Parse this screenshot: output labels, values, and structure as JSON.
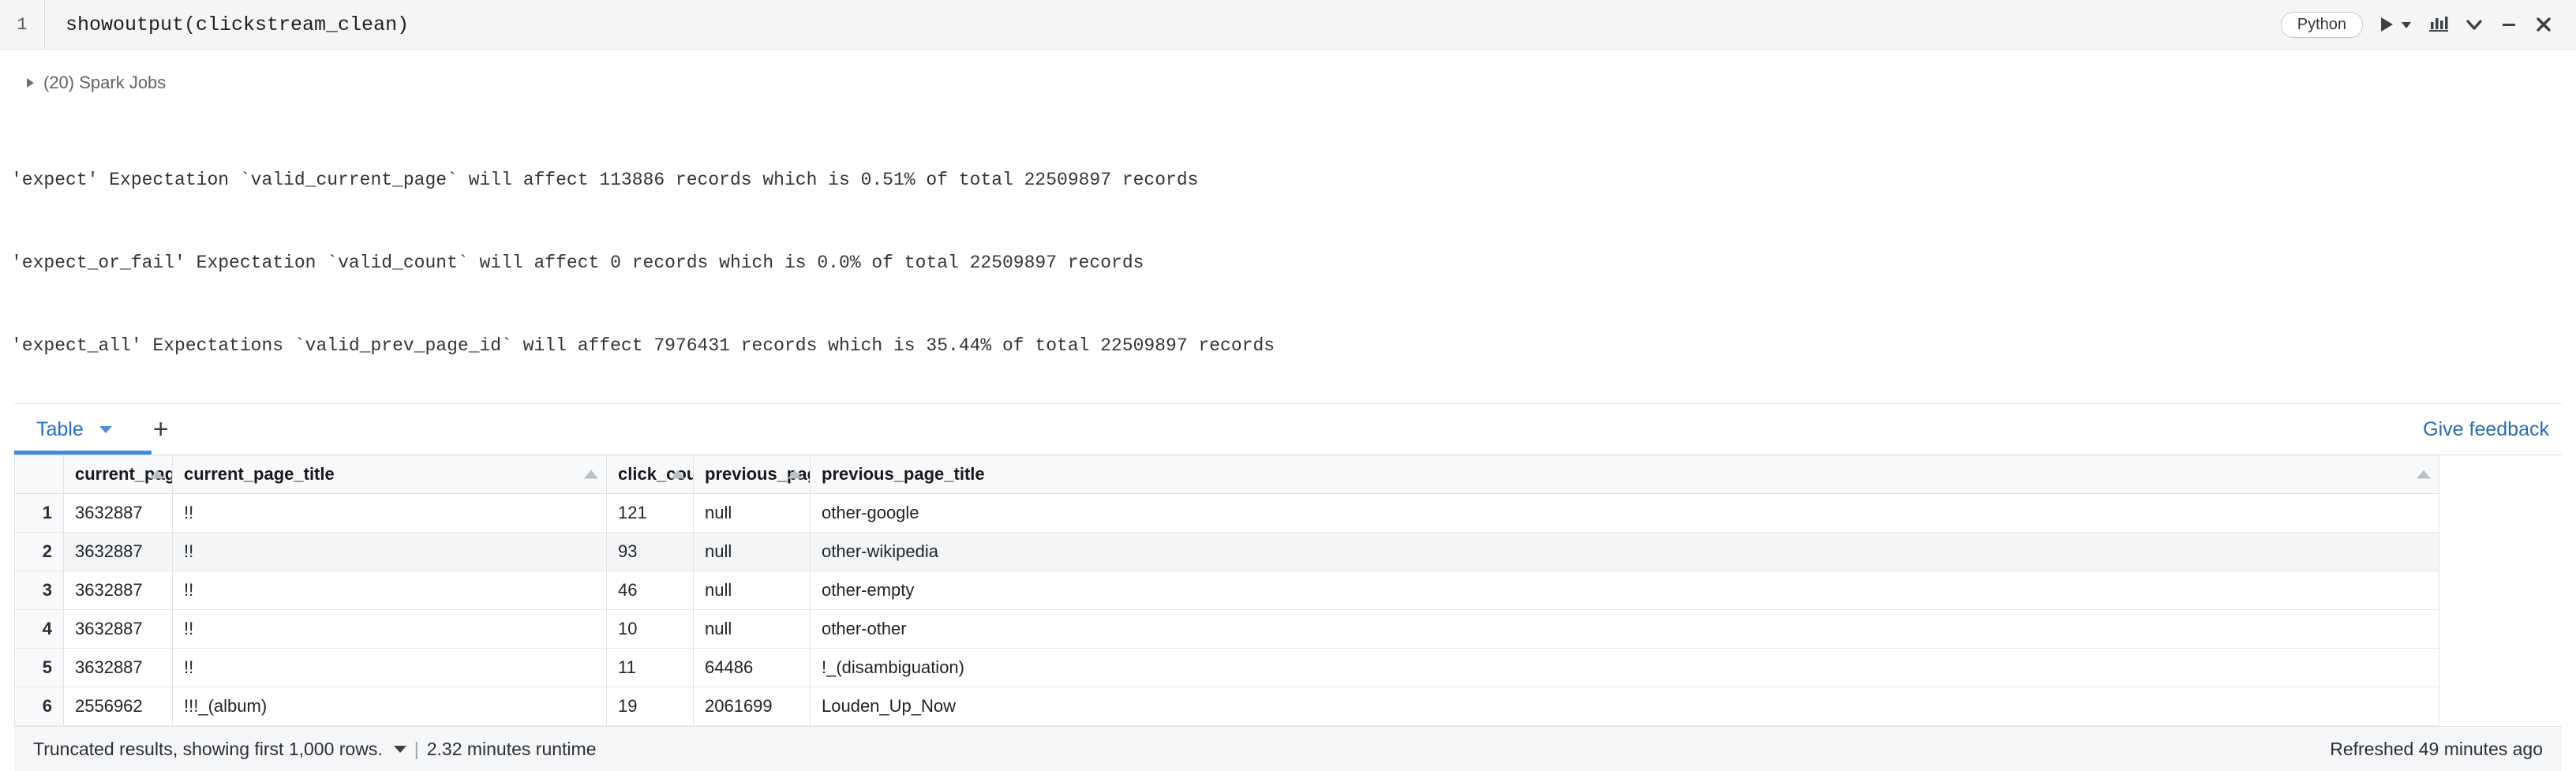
{
  "code_cell": {
    "line_number": "1",
    "code": "showoutput(clickstream_clean)",
    "language_badge": "Python",
    "icons": {
      "run": "run-icon",
      "run_dropdown": "run-dropdown-caret-icon",
      "chart": "chart-icon",
      "collapse": "chevron-down-icon",
      "minimize": "minimize-icon",
      "close": "close-icon"
    }
  },
  "spark_jobs": {
    "caret": "expand-caret-icon",
    "label": "(20) Spark Jobs"
  },
  "expectations": [
    "'expect' Expectation `valid_current_page` will affect 113886 records which is 0.51% of total 22509897 records",
    "'expect_or_fail' Expectation `valid_count` will affect 0 records which is 0.0% of total 22509897 records",
    "'expect_all' Expectations `valid_prev_page_id` will affect 7976431 records which is 35.44% of total 22509897 records"
  ],
  "result_panel": {
    "tabs": [
      {
        "label": "Table",
        "active": true
      }
    ],
    "add_tab_label": "+",
    "feedback_label": "Give feedback",
    "table": {
      "index_header": "",
      "columns": [
        {
          "name": "current_page_id",
          "sortable": true
        },
        {
          "name": "current_page_title",
          "sortable": true
        },
        {
          "name": "click_count",
          "sortable": true
        },
        {
          "name": "previous_page_id",
          "sortable": true
        },
        {
          "name": "previous_page_title",
          "sortable": true
        }
      ],
      "rows": [
        {
          "index": "1",
          "current_page_id": "3632887",
          "current_page_title": "!!",
          "click_count": "121",
          "previous_page_id": "null",
          "previous_page_title": "other-google"
        },
        {
          "index": "2",
          "current_page_id": "3632887",
          "current_page_title": "!!",
          "click_count": "93",
          "previous_page_id": "null",
          "previous_page_title": "other-wikipedia"
        },
        {
          "index": "3",
          "current_page_id": "3632887",
          "current_page_title": "!!",
          "click_count": "46",
          "previous_page_id": "null",
          "previous_page_title": "other-empty"
        },
        {
          "index": "4",
          "current_page_id": "3632887",
          "current_page_title": "!!",
          "click_count": "10",
          "previous_page_id": "null",
          "previous_page_title": "other-other"
        },
        {
          "index": "5",
          "current_page_id": "3632887",
          "current_page_title": "!!",
          "click_count": "11",
          "previous_page_id": "64486",
          "previous_page_title": "!_(disambiguation)"
        },
        {
          "index": "6",
          "current_page_id": "2556962",
          "current_page_title": "!!!_(album)",
          "click_count": "19",
          "previous_page_id": "2061699",
          "previous_page_title": "Louden_Up_Now"
        }
      ]
    }
  },
  "status_bar": {
    "truncation_label": "Truncated results, showing first 1,000 rows.",
    "separator": "|",
    "runtime_label": "2.32 minutes runtime",
    "refreshed_label": "Refreshed 49 minutes ago"
  },
  "colors": {
    "accent_blue": "#2272d0",
    "tab_underline": "#3a8ae8",
    "cell_background": "#f5f5f5",
    "status_background": "#f5f6f7"
  }
}
